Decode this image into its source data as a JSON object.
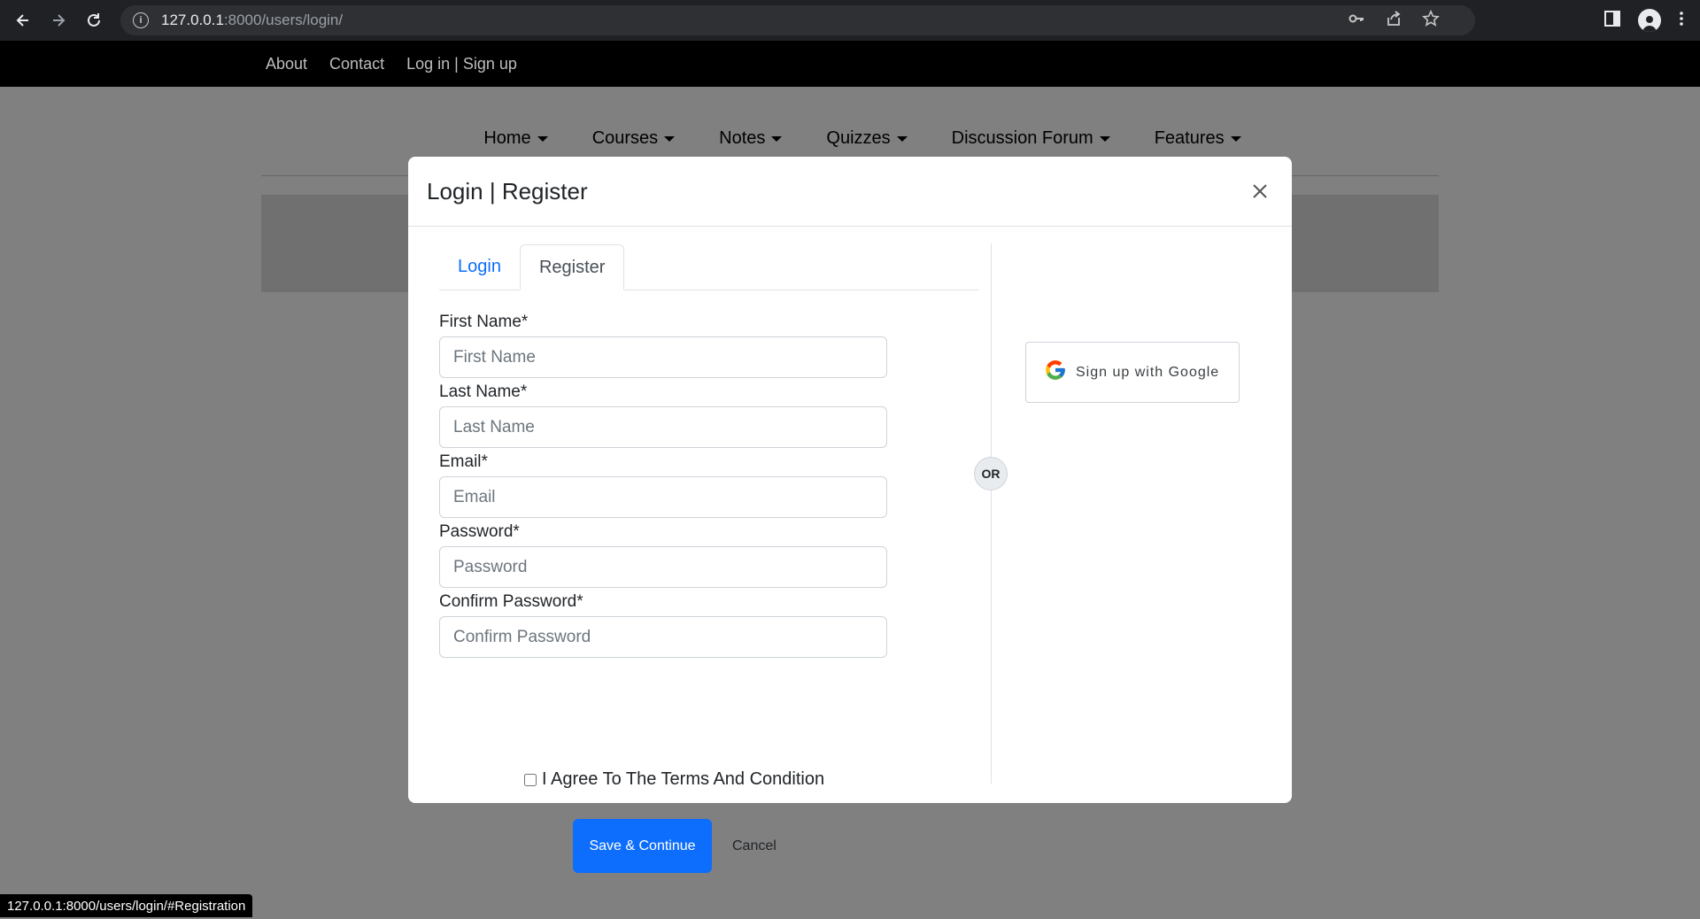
{
  "browser": {
    "url_host": "127.0.0.1",
    "url_rest": ":8000/users/login/",
    "status_url": "127.0.0.1:8000/users/login/#Registration"
  },
  "topbar": {
    "links": [
      "About",
      "Contact",
      "Log in | Sign up"
    ]
  },
  "mainnav": {
    "items": [
      "Home",
      "Courses",
      "Notes",
      "Quizzes",
      "Discussion Forum",
      "Features"
    ]
  },
  "modal": {
    "title": "Login | Register",
    "tabs": {
      "login": "Login",
      "register": "Register"
    },
    "fields": {
      "first_name": {
        "label": "First Name*",
        "placeholder": "First Name"
      },
      "last_name": {
        "label": "Last Name*",
        "placeholder": "Last Name"
      },
      "email": {
        "label": "Email*",
        "placeholder": "Email"
      },
      "password": {
        "label": "Password*",
        "placeholder": "Password"
      },
      "confirm_password": {
        "label": "Confirm Password*",
        "placeholder": "Confirm Password"
      }
    },
    "agree_label": "I Agree To The Terms And Condition",
    "save_label": "Save & Continue",
    "cancel_label": "Cancel",
    "or_label": "OR",
    "google_label": "Sign up with Google"
  },
  "colors": {
    "primary": "#0d6efd",
    "overlay": "#808080",
    "topbar": "#000000"
  }
}
